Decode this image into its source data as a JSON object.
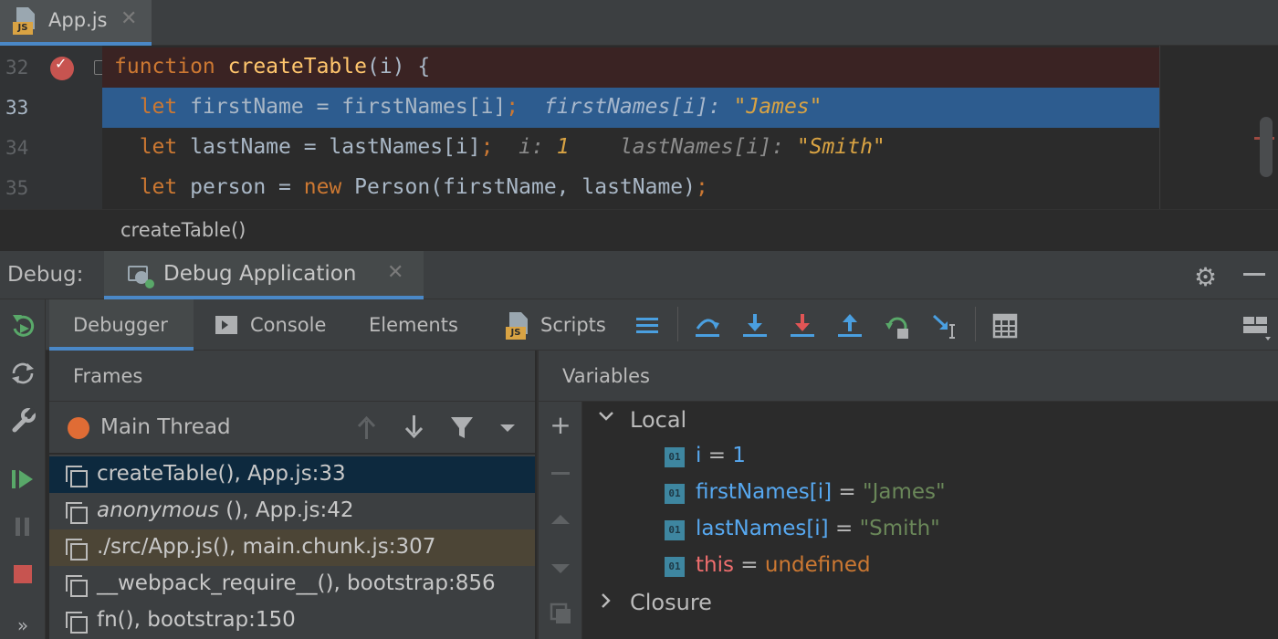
{
  "editor_tab": {
    "file_name": "App.js",
    "file_badge": "JS",
    "close_glyph": "✕"
  },
  "editor": {
    "lines": [
      {
        "number": "32",
        "kw": "function",
        "fn": "createTable",
        "rest": "(i) {"
      },
      {
        "number": "33",
        "kw": "let",
        "code": " firstName = firstNames[i]",
        "semi": ";",
        "inline_name": "firstNames[i]: ",
        "inline_value": "\"James\""
      },
      {
        "number": "34",
        "kw": "let",
        "code": " lastName = lastNames[i]",
        "semi": ";",
        "inline1_name": "i: ",
        "inline1_value": "1",
        "inline2_name": "lastNames[i]: ",
        "inline2_value": "\"Smith\""
      },
      {
        "number": "35",
        "kw": "let",
        "code1": " person = ",
        "kw2": "new",
        "code2": " Person(firstName, lastName)",
        "semi": ";"
      }
    ]
  },
  "breadcrumb": {
    "text": "createTable()"
  },
  "debug_window": {
    "title": "Debug:",
    "session_tab": "Debug Application",
    "close_glyph": "✕"
  },
  "debugger_tabs": {
    "debugger": "Debugger",
    "console": "Console",
    "elements": "Elements",
    "scripts": "Scripts",
    "scripts_badge": "JS"
  },
  "frames": {
    "header": "Frames",
    "thread": "Main Thread",
    "items": [
      {
        "name": "createTable()",
        "location": ", App.js:33"
      },
      {
        "name": "anonymous",
        "location": " (), App.js:42"
      },
      {
        "name": "./src/App.js()",
        "location": ", main.chunk.js:307"
      },
      {
        "name": "__webpack_require__()",
        "location": ", bootstrap:856"
      },
      {
        "name": "fn()",
        "location": ", bootstrap:150"
      }
    ]
  },
  "variables": {
    "header": "Variables",
    "local_label": "Local",
    "closure_label": "Closure",
    "badge": "01",
    "items": [
      {
        "name": "i",
        "eq": " = ",
        "value": "1"
      },
      {
        "name": "firstNames[i]",
        "eq": " = ",
        "value": "\"James\""
      },
      {
        "name": "lastNames[i]",
        "eq": " = ",
        "value": "\"Smith\""
      },
      {
        "name": "this",
        "eq": " = ",
        "value": "undefined"
      }
    ]
  },
  "icons": {
    "rerun": "rerun-icon",
    "restart": "sync-icon",
    "settings": "wrench-icon",
    "resume": "resume-icon",
    "pause": "pause-icon",
    "stop": "stop-icon",
    "more": "chevron-double-right-icon"
  },
  "colors": {
    "accent": "#4a88c7",
    "breakpoint": "#c75450",
    "execution_line": "#2d5c8f",
    "thread_dot": "#e06c35",
    "string": "#6a8759",
    "keyword": "#cc7832"
  }
}
